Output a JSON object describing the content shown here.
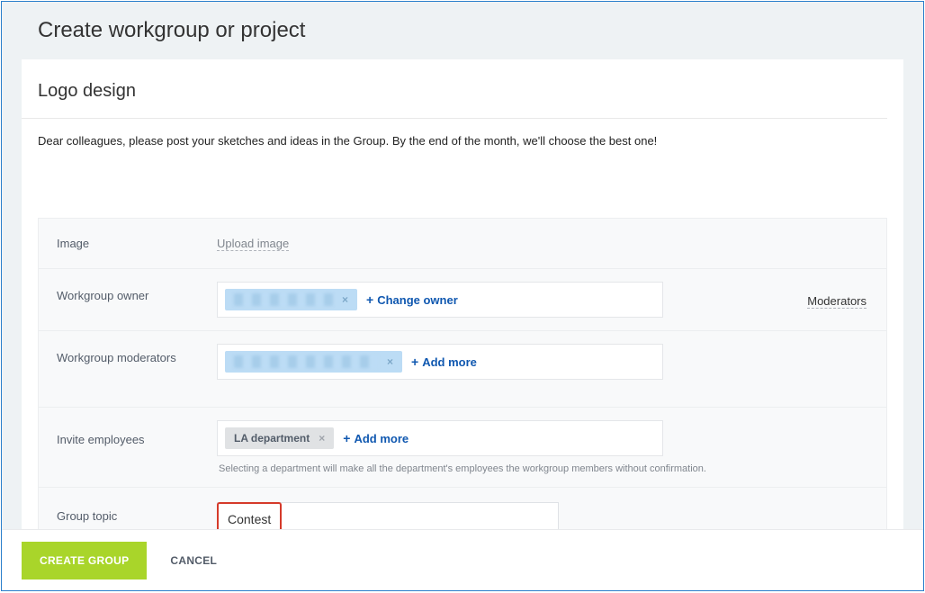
{
  "modal": {
    "title": "Create workgroup or project"
  },
  "group": {
    "name": "Logo design",
    "description": "Dear colleagues, please post your sketches and ideas in the Group. By the end of the month, we'll choose the best one!"
  },
  "form": {
    "image": {
      "label": "Image",
      "upload_label": "Upload image"
    },
    "owner": {
      "label": "Workgroup owner",
      "change_label": "Change owner",
      "moderators_link": "Moderators"
    },
    "moderators": {
      "label": "Workgroup moderators",
      "add_label": "Add more"
    },
    "invite": {
      "label": "Invite employees",
      "add_label": "Add more",
      "chip": "LA department",
      "hint": "Selecting a department will make all the department's employees the workgroup members without confirmation."
    },
    "topic": {
      "label": "Group topic",
      "selected": "Contest"
    }
  },
  "footer": {
    "submit": "CREATE GROUP",
    "cancel": "CANCEL"
  }
}
